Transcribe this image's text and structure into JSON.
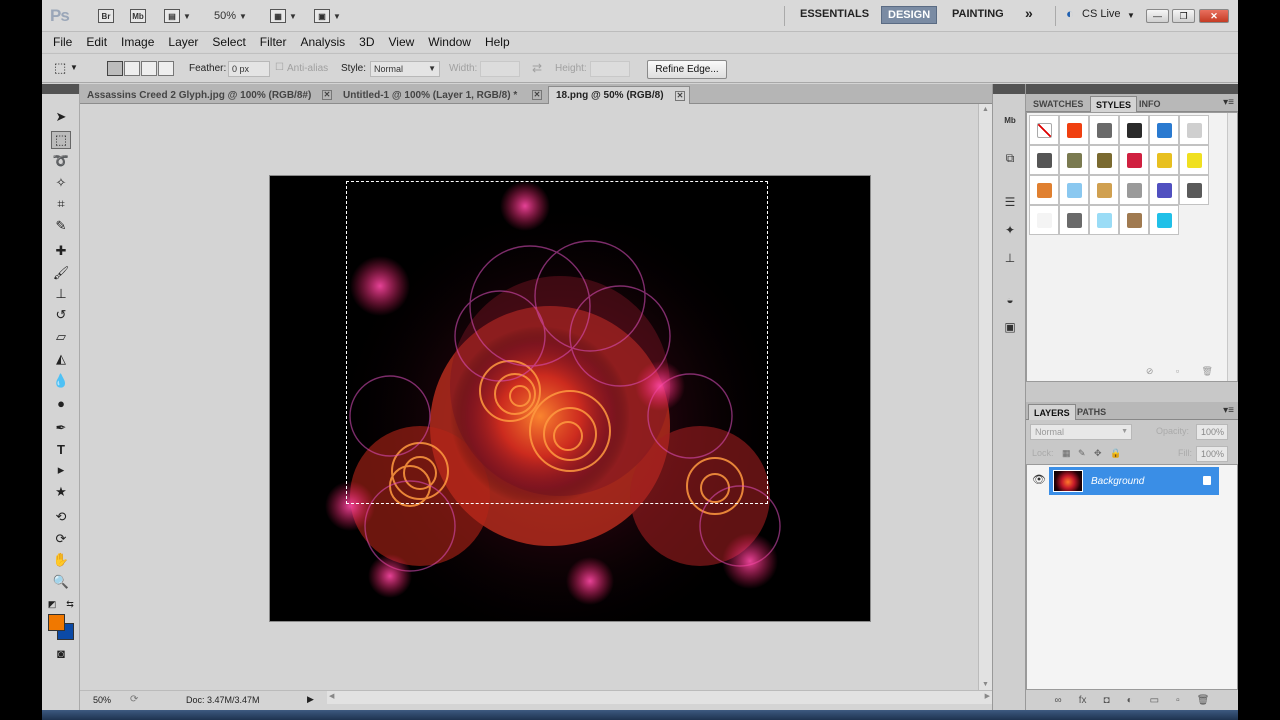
{
  "appbar": {
    "logo": "Ps",
    "bridge": "Br",
    "minibridge": "Mb",
    "zoom": "50%",
    "workspaces": [
      "ESSENTIALS",
      "DESIGN",
      "PAINTING"
    ],
    "more": "»",
    "cslive": "CS Live"
  },
  "menu": [
    "File",
    "Edit",
    "Image",
    "Layer",
    "Select",
    "Filter",
    "Analysis",
    "3D",
    "View",
    "Window",
    "Help"
  ],
  "options": {
    "feather_label": "Feather:",
    "feather_value": "0 px",
    "antialias_label": "Anti-alias",
    "style_label": "Style:",
    "style_value": "Normal",
    "width_label": "Width:",
    "height_label": "Height:",
    "refine_edge": "Refine Edge..."
  },
  "tabs": [
    {
      "title": "Assassins Creed 2 Glyph.jpg @ 100% (RGB/8#)"
    },
    {
      "title": "Untitled-1 @ 100% (Layer 1, RGB/8) *"
    },
    {
      "title": "18.png @ 50% (RGB/8)"
    }
  ],
  "status": {
    "zoom": "50%",
    "doc": "Doc: 3.47M/3.47M"
  },
  "panels": {
    "top_tabs": [
      "SWATCHES",
      "STYLES",
      "INFO"
    ],
    "layers_tabs": [
      "LAYERS",
      "PATHS"
    ],
    "blend_mode": "Normal",
    "opacity_label": "Opacity:",
    "opacity_value": "100%",
    "lock_label": "Lock:",
    "fill_label": "Fill:",
    "fill_value": "100%",
    "layer_name": "Background"
  },
  "colors": {
    "foreground": "#f07800",
    "background": "#0b4aa6",
    "layer_selected": "#3a8ee6",
    "workspace_active": "#7a8ba3"
  },
  "styles": [
    "#ffffff",
    "#f04010",
    "#6a6a6a",
    "#2a2a2a",
    "#2a7ad0",
    "#cfcfcf",
    "#555555",
    "#7a7a50",
    "#7a6a30",
    "#d02040",
    "#e8c020",
    "#f0e020",
    "#e08030",
    "#8ac8f0",
    "#d0a050",
    "#9a9a9a",
    "#5050c0",
    "#5a5a5a",
    "#f4f4f4",
    "#6a6a6a",
    "#9adcf6",
    "#a07a50",
    "#20c0e8"
  ]
}
